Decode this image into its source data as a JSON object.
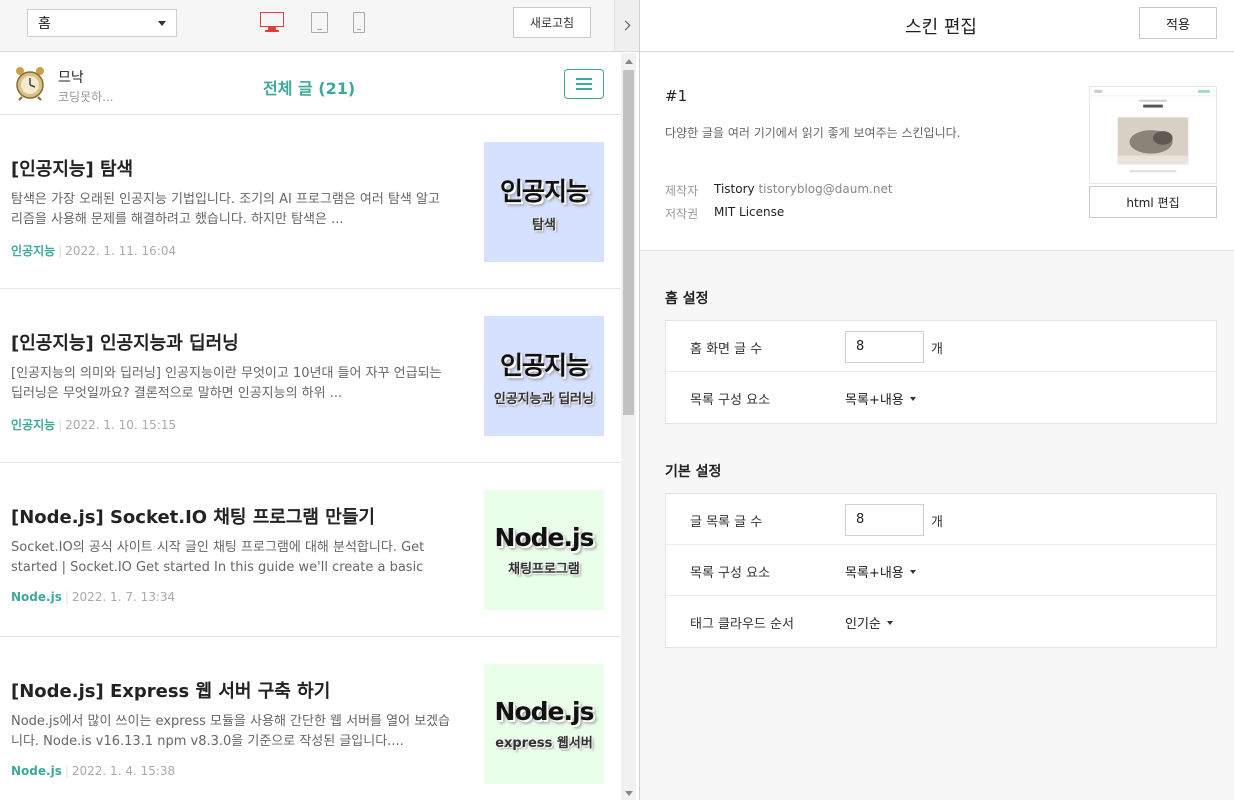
{
  "toolbar": {
    "page_select": "홈",
    "devices": [
      "desktop",
      "tablet",
      "mobile"
    ],
    "active_device": "desktop",
    "refresh_label": "새로고침"
  },
  "blog": {
    "name": "므낙",
    "description": "코딩못하...",
    "post_count": "전체 글 (21)",
    "posts": [
      {
        "title": "[인공지능] 탐색",
        "excerpt": "탐색은 가장 오래된 인공지능 기법입니다. 조기의 AI 프로그램은 여러 탐색 알고리즘을 사용해 문제를 해결하려고 했습니다. 하지만 탐색은 ...",
        "category": "인공지능",
        "date": "2022. 1. 11. 16:04",
        "thumb_main": "인공지능",
        "thumb_sub": "탐색",
        "thumb_bg": "#d6e0ff"
      },
      {
        "title": "[인공지능] 인공지능과 딥러닝",
        "excerpt": "[인공지능의 의미와 딥러닝] 인공지능이란 무엇이고 10년대 들어 자꾸 언급되는 딥러닝은 무엇일까요? 결론적으로 말하면 인공지능의 하위 ...",
        "category": "인공지능",
        "date": "2022. 1. 10. 15:15",
        "thumb_main": "인공지능",
        "thumb_sub": "인공지능과 딥러닝",
        "thumb_bg": "#d6e0ff"
      },
      {
        "title": "[Node.js] Socket.IO 채팅 프로그램 만들기",
        "excerpt": "Socket.IO의 공식 사이트 시작 글인 채팅 프로그램에 대해 분석합니다. Get started | Socket.IO Get started In this guide we'll create a basic ch...",
        "category": "Node.js",
        "date": "2022. 1. 7. 13:34",
        "thumb_main": "Node.js",
        "thumb_sub": "채팅프로그램",
        "thumb_bg": "#eaffea"
      },
      {
        "title": "[Node.js] Express 웹 서버 구축 하기",
        "excerpt": "Node.js에서 많이 쓰이는 express 모듈을 사용해 간단한 웹 서버를 열어 보겠습니다. Node.is v16.13.1 npm v8.3.0을 기준으로 작성된 글입니다....",
        "category": "Node.js",
        "date": "2022. 1. 4. 15:38",
        "thumb_main": "Node.js",
        "thumb_sub": "express 웹서버",
        "thumb_bg": "#eaffea"
      }
    ]
  },
  "editor": {
    "title": "스킨 편집",
    "apply_label": "적용",
    "skin_number": "#1",
    "skin_description": "다양한 글을 여러 기기에서 읽기 좋게 보여주는 스킨입니다.",
    "author_label": "제작자",
    "author_name": "Tistory",
    "author_email": "tistoryblog@daum.net",
    "license_label": "저작권",
    "license_value": "MIT License",
    "html_edit_label": "html 편집",
    "home_section_title": "홈 설정",
    "home_posts_label": "홈 화면 글 수",
    "home_posts_value": "8",
    "home_posts_unit": "개",
    "home_list_label": "목록 구성 요소",
    "home_list_value": "목록+내용",
    "basic_section_title": "기본 설정",
    "list_posts_label": "글 목록 글 수",
    "list_posts_value": "8",
    "list_posts_unit": "개",
    "list_comp_label": "목록 구성 요소",
    "list_comp_value": "목록+내용",
    "tag_order_label": "태그 클라우드 순서",
    "tag_order_value": "인기순"
  },
  "colors": {
    "accent": "#3ea89a",
    "active_device": "#e0403a"
  }
}
